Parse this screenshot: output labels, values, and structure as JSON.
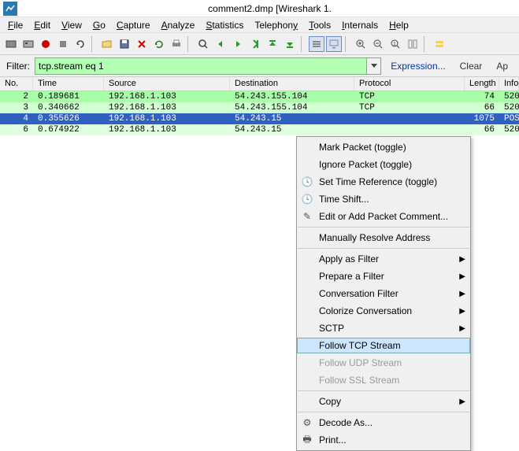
{
  "title": "comment2.dmp   [Wireshark 1.",
  "menus": [
    "File",
    "Edit",
    "View",
    "Go",
    "Capture",
    "Analyze",
    "Statistics",
    "Telephony",
    "Tools",
    "Internals",
    "Help"
  ],
  "filter": {
    "label": "Filter:",
    "value": "tcp.stream eq 1",
    "expression": "Expression...",
    "clear": "Clear",
    "apply": "Ap"
  },
  "columns": {
    "no": "No.",
    "time": "Time",
    "source": "Source",
    "destination": "Destination",
    "protocol": "Protocol",
    "length": "Length",
    "info": "Info"
  },
  "rows": [
    {
      "no": "2",
      "time": "0.189681",
      "src": "192.168.1.103",
      "dst": "54.243.155.104",
      "proto": "TCP",
      "len": "74",
      "info": "520",
      "cls": "row-green"
    },
    {
      "no": "3",
      "time": "0.340662",
      "src": "192.168.1.103",
      "dst": "54.243.155.104",
      "proto": "TCP",
      "len": "66",
      "info": "520",
      "cls": "row-green2"
    },
    {
      "no": "4",
      "time": "0.355626",
      "src": "192.168.1.103",
      "dst": "54.243.15",
      "proto": "",
      "len": "1075",
      "info": "POS",
      "cls": "row-sel"
    },
    {
      "no": "6",
      "time": "0.674922",
      "src": "192.168.1.103",
      "dst": "54.243.15",
      "proto": "",
      "len": "66",
      "info": "520",
      "cls": "row-lightgreen"
    }
  ],
  "context_menu": {
    "mark": "Mark Packet (toggle)",
    "ignore": "Ignore Packet (toggle)",
    "timeref": "Set Time Reference (toggle)",
    "timeshift": "Time Shift...",
    "editcomment": "Edit or Add Packet Comment...",
    "resolve": "Manually Resolve Address",
    "applyfilter": "Apply as Filter",
    "prepfilter": "Prepare a Filter",
    "convfilter": "Conversation Filter",
    "colorize": "Colorize Conversation",
    "sctp": "SCTP",
    "followtcp": "Follow TCP Stream",
    "followudp": "Follow UDP Stream",
    "followssl": "Follow SSL Stream",
    "copy": "Copy",
    "decode": "Decode As...",
    "print": "Print..."
  }
}
